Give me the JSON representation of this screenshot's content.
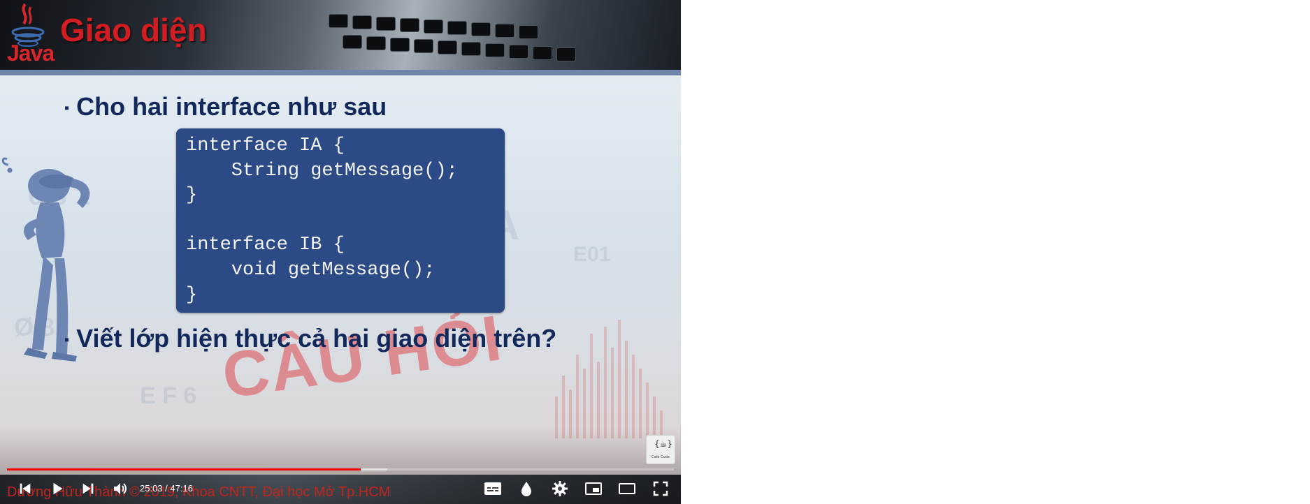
{
  "slide": {
    "banner_title": "Giao diện",
    "logo_text": "Java",
    "bullet1": "Cho hai interface như sau",
    "code": "interface IA {\n    String getMessage();\n}\n\ninterface IB {\n    void getMessage();\n}",
    "bullet2": "Viết lớp hiện thực cả hai giao diện trên?",
    "stamp": "CÂU HỎI",
    "channel_badge": "Café Code"
  },
  "caption": "Dương Hữu Thành © 2019, Khoa CNTT, Đại học Mở Tp.HCM",
  "player": {
    "current_time": "25:03",
    "separator": " / ",
    "duration": "47:16",
    "progress_played": 0.53,
    "progress_buffered": 0.57,
    "accent_color": "#ff0000",
    "icons": [
      "skip-back-icon",
      "play-icon",
      "skip-next-icon",
      "volume-icon",
      "subtitles-icon",
      "drop-icon",
      "settings-gear-icon",
      "miniplayer-icon",
      "theater-mode-icon",
      "fullscreen-icon"
    ]
  }
}
